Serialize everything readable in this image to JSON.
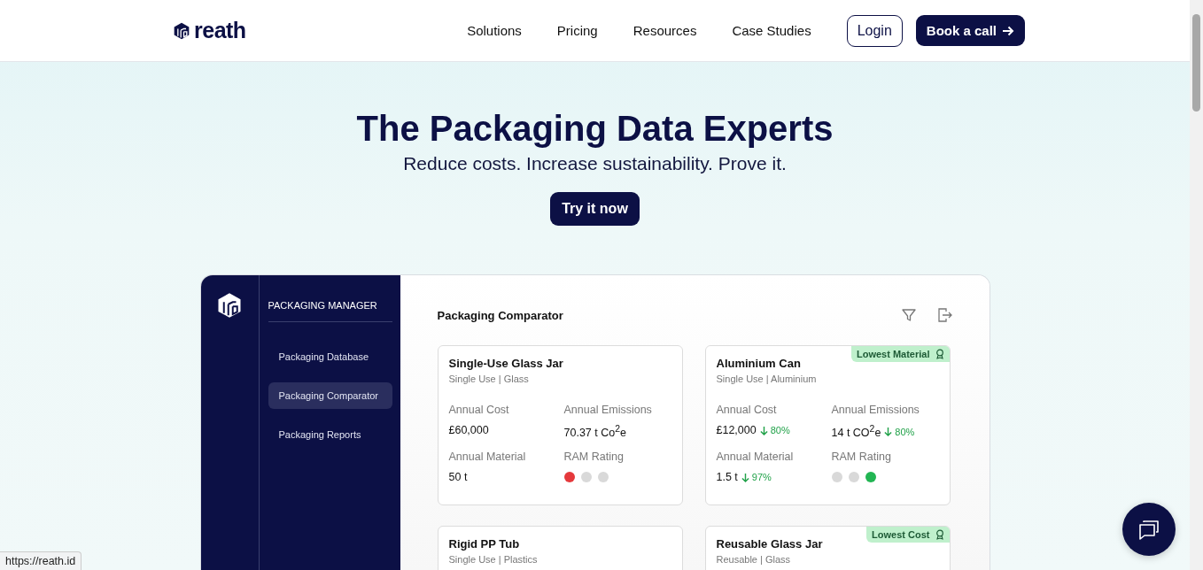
{
  "header": {
    "brand": "reath",
    "nav": [
      "Solutions",
      "Pricing",
      "Resources",
      "Case Studies"
    ],
    "login": "Login",
    "cta": "Book a call"
  },
  "hero": {
    "title": "The Packaging Data Experts",
    "subtitle": "Reduce costs. Increase sustainability. Prove it.",
    "button": "Try it now"
  },
  "app": {
    "sidebar": {
      "heading": "PACKAGING MANAGER",
      "items": [
        {
          "label": "Packaging Database",
          "selected": false
        },
        {
          "label": "Packaging Comparator",
          "selected": true
        },
        {
          "label": "Packaging Reports",
          "selected": false
        }
      ]
    },
    "title": "Packaging Comparator",
    "cards": [
      {
        "title": "Single-Use Glass Jar",
        "subtitle": "Single Use | Glass",
        "metrics": [
          {
            "kind": "value",
            "label": "Annual Cost",
            "value": "£60,000"
          },
          {
            "kind": "value",
            "label": "Annual Emissions",
            "value": "70.37 t Co$^{2}$e"
          },
          {
            "kind": "value",
            "label": "Annual Material",
            "value": "50 t"
          },
          {
            "kind": "rating",
            "label": "RAM Rating",
            "dots": [
              {
                "color": "#e5393c"
              },
              {
                "color": "#d9d9d9"
              },
              {
                "color": "#d9d9d9"
              }
            ]
          }
        ]
      },
      {
        "title": "Aluminium Can",
        "subtitle": "Single Use | Aluminium",
        "badge": "Lowest Material",
        "metrics": [
          {
            "kind": "value",
            "label": "Annual Cost",
            "value": "£12,000",
            "change": "80%"
          },
          {
            "kind": "value",
            "label": "Annual Emissions",
            "value": "14 t CO$^{2}$e",
            "change": "80%"
          },
          {
            "kind": "value",
            "label": "Annual Material",
            "value": "1.5 t",
            "change": "97%"
          },
          {
            "kind": "rating",
            "label": "RAM Rating",
            "dots": [
              {
                "color": "#d9d9d9"
              },
              {
                "color": "#d9d9d9"
              },
              {
                "color": "#22b553"
              }
            ]
          }
        ]
      },
      {
        "title": "Rigid PP Tub",
        "subtitle": "Single Use | Plastics"
      },
      {
        "title": "Reusable Glass Jar",
        "subtitle": "Reusable | Glass",
        "badge": "Lowest Cost"
      }
    ]
  },
  "status_url": "https://reath.id"
}
